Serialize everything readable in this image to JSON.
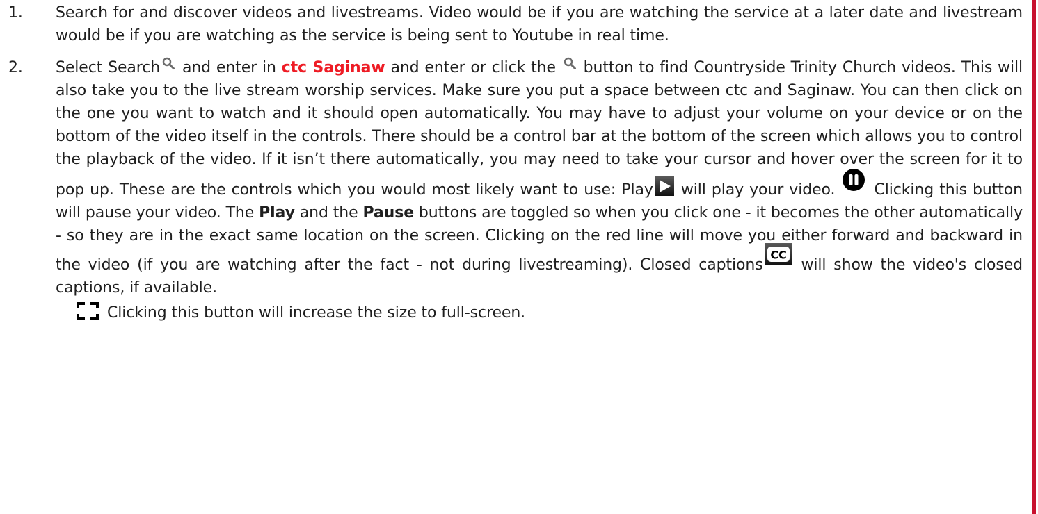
{
  "doc": {
    "item1": {
      "number": "1.",
      "text": "Search for and discover videos and livestreams.  Video would be if you are watching the service at a later date and livestream would be if you are watching as the service is being sent to Youtube in real time."
    },
    "item2": {
      "number": "2.",
      "t1": "Select Search",
      "t2": " and enter in ",
      "highlight": "ctc Saginaw",
      "t3": " and enter or click the",
      "t4": " button to find Countryside Trinity Church videos. This will also take you to the live stream worship services.  Make sure you put a space between ctc and Saginaw.  You can then click on the one you want to watch and it should open automatically.  You may have to adjust your volume on your device or on the bottom of the video itself in the controls. There should be a control bar at the bottom of the screen which allows you to control the playback of the video.  If it isn’t there automatically, you may need to take your cursor and hover over the screen for it to pop up.  These are the controls which you would most likely want to use:  Play",
      "t5": " will play your video.",
      "t6": " Clicking this button will pause your video.  The ",
      "play_word": "Play",
      "t7": " and the ",
      "pause_word": "Pause",
      "t8": " buttons are toggled so when you click one - it becomes the other automatically - so they are in the exact same location on the screen.  Clicking on the red line will move you either forward and backward in the video (if you are watching after the fact - not during livestreaming).  Closed captions",
      "t9": " will show the video's closed captions, if available.",
      "t10": "Clicking this button will increase the size to full-screen."
    }
  },
  "colors": {
    "highlight": "#ee1c25",
    "accent_rule": "#c8102e",
    "text": "#1f1f1f"
  },
  "icons": {
    "search": "search-icon",
    "play": "play-icon",
    "pause": "pause-icon",
    "closed_captions": "closed-captions-icon",
    "fullscreen": "fullscreen-icon"
  }
}
